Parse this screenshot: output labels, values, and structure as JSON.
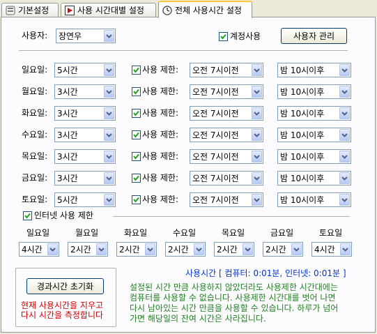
{
  "tabs": [
    {
      "label": "기본설정",
      "icon": "gear-tab-icon"
    },
    {
      "label": "사용 시간대별 설정",
      "icon": "play-tab-icon"
    },
    {
      "label": "전체 사용시간 설정",
      "icon": "clock-tab-icon"
    }
  ],
  "user": {
    "label": "사용자:",
    "selected": "장연우",
    "account_use_label": "계정사용",
    "manage_button": "사용자 관리"
  },
  "days": [
    {
      "label": "일요일:",
      "hours": "5시간",
      "limit_label": "사용 제한:",
      "start": "오전 7시이전",
      "end": "밤 10시이후"
    },
    {
      "label": "월요일:",
      "hours": "3시간",
      "limit_label": "사용 제한:",
      "start": "오전 7시이전",
      "end": "밤 10시이후"
    },
    {
      "label": "화요일:",
      "hours": "3시간",
      "limit_label": "사용 제한:",
      "start": "오전 7시이전",
      "end": "밤 10시이후"
    },
    {
      "label": "수요일:",
      "hours": "3시간",
      "limit_label": "사용 제한:",
      "start": "오전 7시이전",
      "end": "밤 10시이후"
    },
    {
      "label": "목요일:",
      "hours": "3시간",
      "limit_label": "사용 제한:",
      "start": "오전 7시이전",
      "end": "밤 10시이후"
    },
    {
      "label": "금요일:",
      "hours": "3시간",
      "limit_label": "사용 제한:",
      "start": "오전 7시이전",
      "end": "밤 10시이후"
    },
    {
      "label": "토요일:",
      "hours": "5시간",
      "limit_label": "사용 제한:",
      "start": "오전 7시이전",
      "end": "밤 10시이후"
    }
  ],
  "internet": {
    "label": "인터넷 사용 제한",
    "days": [
      {
        "label": "일요일",
        "value": "4시간"
      },
      {
        "label": "월요일",
        "value": "2시간"
      },
      {
        "label": "화요일",
        "value": "2시간"
      },
      {
        "label": "수요일",
        "value": "2시간"
      },
      {
        "label": "목요일",
        "value": "2시간"
      },
      {
        "label": "금요일",
        "value": "2시간"
      },
      {
        "label": "토요일",
        "value": "4시간"
      }
    ]
  },
  "reset": {
    "button": "경과시간 초기화",
    "note_line1": "현재 사용시간을 지우고",
    "note_line2": "다시 시간을 측정합니다"
  },
  "usage_status": "사용시간 [ 컴퓨터: 0:01분, 인터넷: 0:01분 ]",
  "info_lines": [
    "설정된 시간 만큼 사용하지 않았더라도 사용제한 시간대에는",
    "컴퓨터를 사용할 수 없습니다. 사용제한 시간대를 벗어 나면",
    "다시 남아있는 시간 만큼을 사용할 수 있습니다. 하루가 넘어",
    "가면 해당일의 잔여 시간은 사라집니다."
  ],
  "colors": {
    "reset_note": "#cc0000",
    "usage_status": "#0033cc",
    "info_text": "#208020"
  }
}
